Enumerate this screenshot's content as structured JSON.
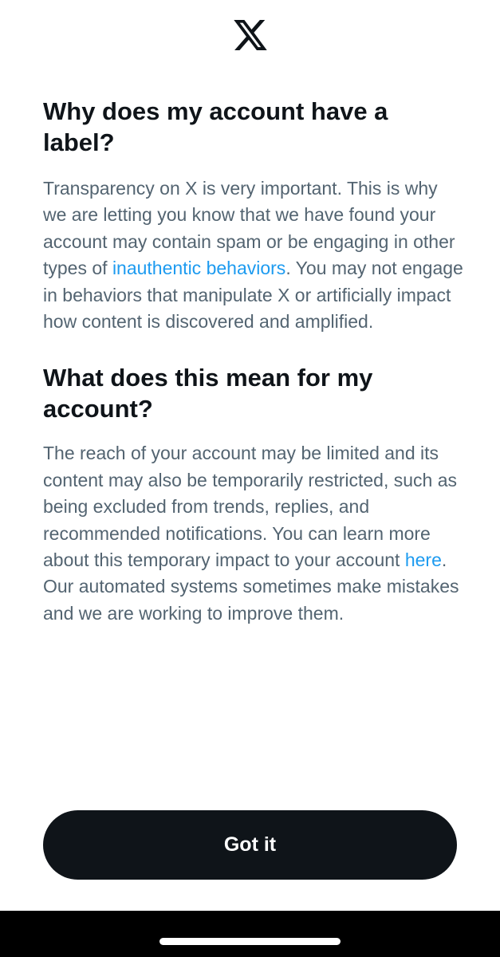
{
  "logo": {
    "icon": "x-logo-icon"
  },
  "section1": {
    "title": "Why does my account have a label?",
    "body_before_link": "Transparency on X is very important. This is why we are letting you know that we have found your account may contain spam or be engaging in other types of ",
    "link_text": "inauthentic behaviors",
    "body_after_link": ". You may not engage in behaviors that manipulate X or artificially impact how content is discovered and amplified."
  },
  "section2": {
    "title": "What does this mean for my account?",
    "body_before_link": "The reach of your account may be limited and its content may also be temporarily restricted, such as being excluded from trends, replies, and recommended notifications. You can learn more about this temporary impact to your account ",
    "link_text": "here",
    "body_after_link": ". Our automated systems sometimes make mistakes and we are working to improve them."
  },
  "button": {
    "label": "Got it"
  },
  "colors": {
    "link": "#1d9bf0",
    "body_text": "#536471",
    "heading": "#0f1419",
    "button_bg": "#0f1419"
  }
}
